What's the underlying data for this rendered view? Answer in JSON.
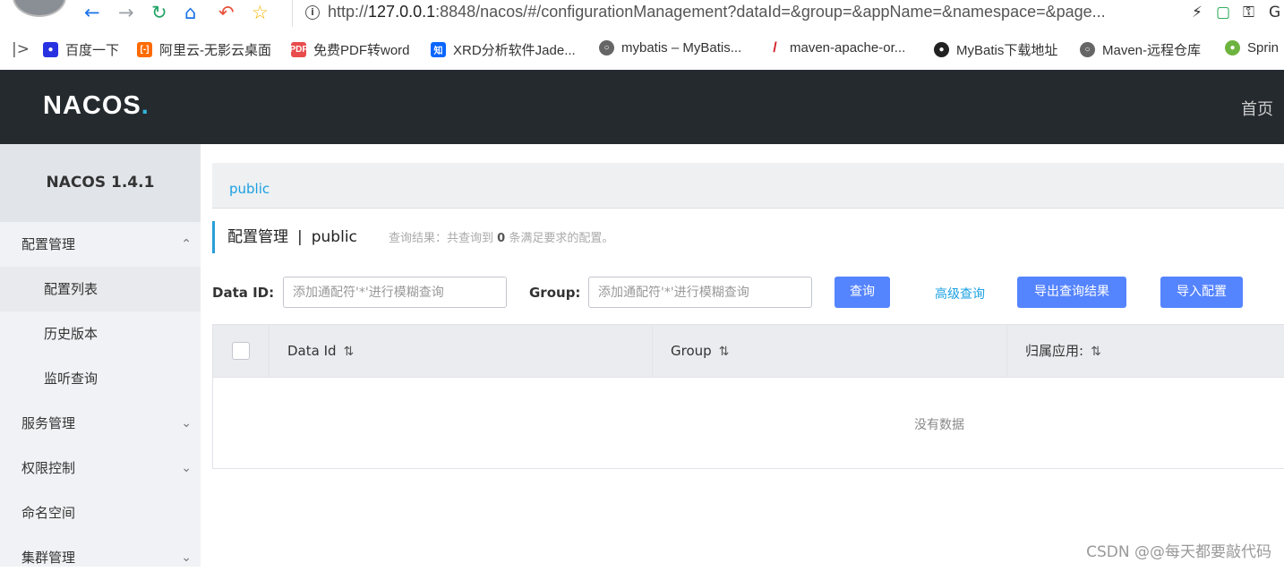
{
  "browser": {
    "url_prefix": "http://",
    "url_host": "127.0.0.1",
    "url_rest": ":8848/nacos/#/configurationManagement?dataId=&group=&appName=&namespace=&page..."
  },
  "bookmarks": [
    {
      "label": "百度一下",
      "icon": "baidu-icon",
      "color": "#2932e1"
    },
    {
      "label": "阿里云-无影云桌面",
      "icon": "aliyun-icon",
      "color": "#ff6a00"
    },
    {
      "label": "免费PDF转word",
      "icon": "pdf-icon",
      "color": "#e84c4c"
    },
    {
      "label": "XRD分析软件Jade...",
      "icon": "zhihu-icon",
      "color": "#0a66ff"
    },
    {
      "label": "mybatis – MyBatis...",
      "icon": "globe-icon",
      "color": "#666666"
    },
    {
      "label": "maven-apache-or...",
      "icon": "feather-icon",
      "color": "#d22128"
    },
    {
      "label": "MyBatis下载地址",
      "icon": "github-icon",
      "color": "#222222"
    },
    {
      "label": "Maven-远程仓库",
      "icon": "globe-icon",
      "color": "#666666"
    },
    {
      "label": "Sprin",
      "icon": "spring-icon",
      "color": "#6db33f"
    }
  ],
  "header": {
    "logo": "NACOS",
    "logo_dot": ".",
    "home_link": "首页"
  },
  "sidebar": {
    "version": "NACOS 1.4.1",
    "config_management": "配置管理",
    "config_list": "配置列表",
    "history_versions": "历史版本",
    "listener_query": "监听查询",
    "service_management": "服务管理",
    "access_control": "权限控制",
    "namespace": "命名空间",
    "cluster_management": "集群管理"
  },
  "main": {
    "breadcrumb": "public",
    "page_title": "配置管理",
    "page_sep": "|",
    "namespace": "public",
    "query_prefix": "查询结果：共查询到",
    "query_count": "0",
    "query_suffix": "条满足要求的配置。",
    "dataid_label": "Data ID:",
    "dataid_placeholder": "添加通配符'*'进行模糊查询",
    "group_label": "Group:",
    "group_placeholder": "添加通配符'*'进行模糊查询",
    "query_button": "查询",
    "advanced_query": "高级查询",
    "export_button": "导出查询结果",
    "import_button": "导入配置"
  },
  "table": {
    "columns": [
      "Data Id",
      "Group",
      "归属应用:"
    ],
    "empty_text": "没有数据"
  },
  "watermark": "CSDN @@每天都要敲代码",
  "colors": {
    "header_bg": "#252a2f",
    "accent": "#5584ff",
    "link": "#1ba1e2"
  }
}
